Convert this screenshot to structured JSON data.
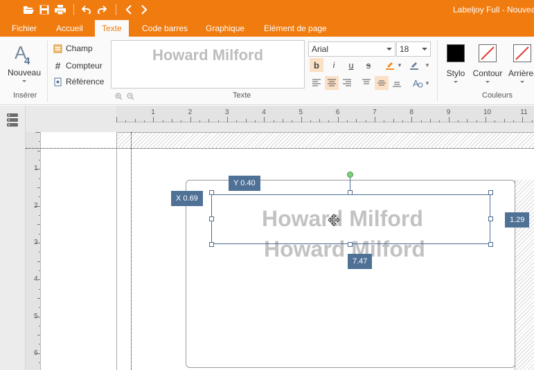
{
  "app": {
    "title": "Labeljoy Full - Nouveau"
  },
  "quick_access": {
    "icons": [
      "open-folder-icon",
      "save-icon",
      "print-icon",
      "undo-icon",
      "redo-icon",
      "back-icon",
      "forward-icon"
    ]
  },
  "tabs": [
    {
      "label": "Fichier",
      "active": false
    },
    {
      "label": "Accueil",
      "active": false
    },
    {
      "label": "Texte",
      "active": true
    },
    {
      "label": "Code barres",
      "active": false
    },
    {
      "label": "Graphique",
      "active": false
    },
    {
      "label": "Elément de page",
      "active": false
    }
  ],
  "ribbon": {
    "insert_group": {
      "new_label": "Nouveau",
      "group_label": "Insérer",
      "field_label": "Champ",
      "counter_label": "Compteur",
      "reference_label": "Référence"
    },
    "text_group": {
      "preview_text": "Howard Milford",
      "font_family": "Arial",
      "font_size": "18",
      "group_label": "Texte"
    },
    "colors_group": {
      "stylo_label": "Stylo",
      "contour_label": "Contour",
      "background_label": "Arrière-",
      "group_label": "Couleurs",
      "stylo_color": "#000000"
    }
  },
  "rulers": {
    "horizontal": [
      "1",
      "2",
      "3",
      "4",
      "5",
      "6",
      "7",
      "8",
      "9",
      "10",
      "11"
    ],
    "vertical": [
      "1",
      "2",
      "3",
      "4",
      "5",
      "6"
    ]
  },
  "canvas": {
    "text_selected": "Howard Milford",
    "text_second": "Howard Milford",
    "badge_y": "Y 0.40",
    "badge_x": "X 0.69",
    "badge_height": "1.29",
    "badge_width": "7.47"
  },
  "colors": {
    "accent": "#f07b0f",
    "badge": "#4f7196",
    "selection": "#4a6a92"
  }
}
